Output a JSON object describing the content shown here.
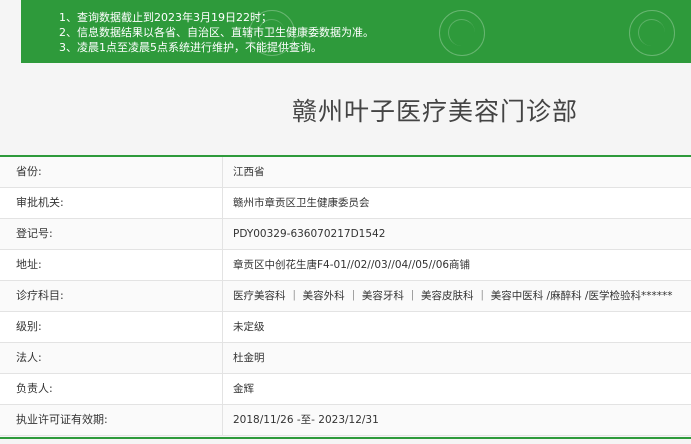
{
  "notice": {
    "lines": [
      "1、查询数据截止到2023年3月19日22时；",
      "2、信息数据结果以各省、自治区、直辖市卫生健康委数据为准。",
      "3、凌晨1点至凌晨5点系统进行维护，不能提供查询。"
    ]
  },
  "title": "赣州叶子医疗美容门诊部",
  "rows": [
    {
      "label": "省份:",
      "value": "江西省"
    },
    {
      "label": "审批机关:",
      "value": "赣州市章贡区卫生健康委员会"
    },
    {
      "label": "登记号:",
      "value": "PDY00329-636070217D1542"
    },
    {
      "label": "地址:",
      "value": "章贡区中创花生唐F4-01//02//03//04//05//06商铺"
    },
    {
      "label": "诊疗科目:",
      "value": "医疗美容科 ｜ 美容外科 ｜ 美容牙科 ｜ 美容皮肤科 ｜ 美容中医科 /麻醉科 /医学检验科******"
    },
    {
      "label": "级别:",
      "value": "未定级"
    },
    {
      "label": "法人:",
      "value": "杜金明"
    },
    {
      "label": "负责人:",
      "value": "金辉"
    },
    {
      "label": "执业许可证有效期:",
      "value": "2018/11/26 -至- 2023/12/31"
    }
  ]
}
